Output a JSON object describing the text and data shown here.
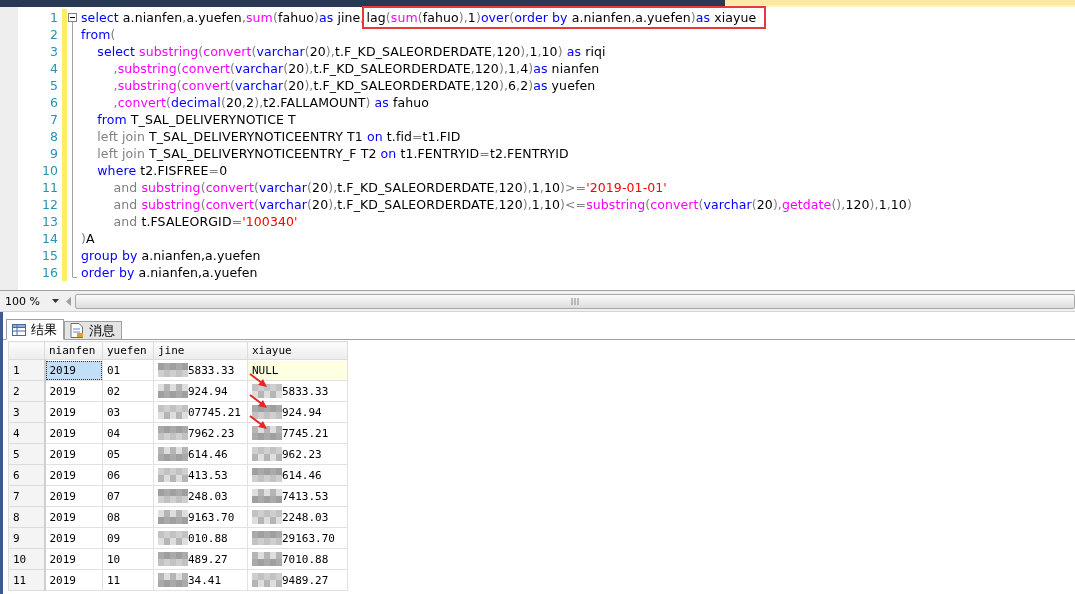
{
  "editor": {
    "lines": [
      {
        "number": "1",
        "segments": [
          {
            "boxed": false,
            "tokens": [
              {
                "kind": "keyword",
                "text": "select"
              },
              {
                "kind": "ident",
                "text": " a.nianfen"
              },
              {
                "kind": "punct",
                "text": ","
              },
              {
                "kind": "ident",
                "text": "a.yuefen"
              },
              {
                "kind": "punct",
                "text": ","
              },
              {
                "kind": "func",
                "text": "sum"
              },
              {
                "kind": "punct",
                "text": "("
              },
              {
                "kind": "ident",
                "text": "fahuo"
              },
              {
                "kind": "punct",
                "text": ")"
              },
              {
                "kind": "keyword",
                "text": "as"
              },
              {
                "kind": "ident",
                "text": " jine"
              },
              {
                "kind": "punct",
                "text": ","
              }
            ]
          },
          {
            "boxed": true,
            "tokens": [
              {
                "kind": "ident",
                "text": "lag"
              },
              {
                "kind": "punct",
                "text": "("
              },
              {
                "kind": "func",
                "text": "sum"
              },
              {
                "kind": "punct",
                "text": "("
              },
              {
                "kind": "ident",
                "text": "fahuo"
              },
              {
                "kind": "punct",
                "text": "),"
              },
              {
                "kind": "ident",
                "text": "1"
              },
              {
                "kind": "punct",
                "text": ")"
              },
              {
                "kind": "keyword",
                "text": "over"
              },
              {
                "kind": "punct",
                "text": "("
              },
              {
                "kind": "keyword",
                "text": "order by"
              },
              {
                "kind": "ident",
                "text": " a.nianfen"
              },
              {
                "kind": "punct",
                "text": ","
              },
              {
                "kind": "ident",
                "text": "a.yuefen"
              },
              {
                "kind": "punct",
                "text": ")"
              },
              {
                "kind": "keyword",
                "text": "as"
              },
              {
                "kind": "ident",
                "text": " xiayue"
              }
            ]
          }
        ]
      },
      {
        "number": "2",
        "segments": [
          {
            "boxed": false,
            "tokens": [
              {
                "kind": "keyword",
                "text": "from"
              },
              {
                "kind": "punct",
                "text": "("
              }
            ]
          }
        ]
      },
      {
        "number": "3",
        "segments": [
          {
            "boxed": false,
            "tokens": [
              {
                "kind": "keyword",
                "text": "    select "
              },
              {
                "kind": "func",
                "text": "substring"
              },
              {
                "kind": "punct",
                "text": "("
              },
              {
                "kind": "func",
                "text": "convert"
              },
              {
                "kind": "punct",
                "text": "("
              },
              {
                "kind": "keyword",
                "text": "varchar"
              },
              {
                "kind": "punct",
                "text": "("
              },
              {
                "kind": "ident",
                "text": "20"
              },
              {
                "kind": "punct",
                "text": "),"
              },
              {
                "kind": "ident",
                "text": "t.F_KD_SALEORDERDATE"
              },
              {
                "kind": "punct",
                "text": ","
              },
              {
                "kind": "ident",
                "text": "120"
              },
              {
                "kind": "punct",
                "text": "),"
              },
              {
                "kind": "ident",
                "text": "1"
              },
              {
                "kind": "punct",
                "text": ","
              },
              {
                "kind": "ident",
                "text": "10"
              },
              {
                "kind": "punct",
                "text": ") "
              },
              {
                "kind": "keyword",
                "text": "as"
              },
              {
                "kind": "ident",
                "text": " riqi"
              }
            ]
          }
        ]
      },
      {
        "number": "4",
        "segments": [
          {
            "boxed": false,
            "tokens": [
              {
                "kind": "punct",
                "text": "        ,"
              },
              {
                "kind": "func",
                "text": "substring"
              },
              {
                "kind": "punct",
                "text": "("
              },
              {
                "kind": "func",
                "text": "convert"
              },
              {
                "kind": "punct",
                "text": "("
              },
              {
                "kind": "keyword",
                "text": "varchar"
              },
              {
                "kind": "punct",
                "text": "("
              },
              {
                "kind": "ident",
                "text": "20"
              },
              {
                "kind": "punct",
                "text": "),"
              },
              {
                "kind": "ident",
                "text": "t.F_KD_SALEORDERDATE"
              },
              {
                "kind": "punct",
                "text": ","
              },
              {
                "kind": "ident",
                "text": "120"
              },
              {
                "kind": "punct",
                "text": "),"
              },
              {
                "kind": "ident",
                "text": "1"
              },
              {
                "kind": "punct",
                "text": ","
              },
              {
                "kind": "ident",
                "text": "4"
              },
              {
                "kind": "punct",
                "text": ")"
              },
              {
                "kind": "keyword",
                "text": "as"
              },
              {
                "kind": "ident",
                "text": " nianfen"
              }
            ]
          }
        ]
      },
      {
        "number": "5",
        "segments": [
          {
            "boxed": false,
            "tokens": [
              {
                "kind": "punct",
                "text": "        ,"
              },
              {
                "kind": "func",
                "text": "substring"
              },
              {
                "kind": "punct",
                "text": "("
              },
              {
                "kind": "func",
                "text": "convert"
              },
              {
                "kind": "punct",
                "text": "("
              },
              {
                "kind": "keyword",
                "text": "varchar"
              },
              {
                "kind": "punct",
                "text": "("
              },
              {
                "kind": "ident",
                "text": "20"
              },
              {
                "kind": "punct",
                "text": "),"
              },
              {
                "kind": "ident",
                "text": "t.F_KD_SALEORDERDATE"
              },
              {
                "kind": "punct",
                "text": ","
              },
              {
                "kind": "ident",
                "text": "120"
              },
              {
                "kind": "punct",
                "text": "),"
              },
              {
                "kind": "ident",
                "text": "6"
              },
              {
                "kind": "punct",
                "text": ","
              },
              {
                "kind": "ident",
                "text": "2"
              },
              {
                "kind": "punct",
                "text": ")"
              },
              {
                "kind": "keyword",
                "text": "as"
              },
              {
                "kind": "ident",
                "text": " yuefen"
              }
            ]
          }
        ]
      },
      {
        "number": "6",
        "segments": [
          {
            "boxed": false,
            "tokens": [
              {
                "kind": "punct",
                "text": "        ,"
              },
              {
                "kind": "func",
                "text": "convert"
              },
              {
                "kind": "punct",
                "text": "("
              },
              {
                "kind": "keyword",
                "text": "decimal"
              },
              {
                "kind": "punct",
                "text": "("
              },
              {
                "kind": "ident",
                "text": "20"
              },
              {
                "kind": "punct",
                "text": ","
              },
              {
                "kind": "ident",
                "text": "2"
              },
              {
                "kind": "punct",
                "text": "),"
              },
              {
                "kind": "ident",
                "text": "t2.FALLAMOUNT"
              },
              {
                "kind": "punct",
                "text": ") "
              },
              {
                "kind": "keyword",
                "text": "as"
              },
              {
                "kind": "ident",
                "text": " fahuo"
              }
            ]
          }
        ]
      },
      {
        "number": "7",
        "segments": [
          {
            "boxed": false,
            "tokens": [
              {
                "kind": "keyword",
                "text": "    from"
              },
              {
                "kind": "ident",
                "text": " T_SAL_DELIVERYNOTICE T"
              }
            ]
          }
        ]
      },
      {
        "number": "8",
        "segments": [
          {
            "boxed": false,
            "tokens": [
              {
                "kind": "punct",
                "text": "    left join"
              },
              {
                "kind": "ident",
                "text": " T_SAL_DELIVERYNOTICEENTRY T1 "
              },
              {
                "kind": "keyword",
                "text": "on"
              },
              {
                "kind": "ident",
                "text": " t.fid"
              },
              {
                "kind": "punct",
                "text": "="
              },
              {
                "kind": "ident",
                "text": "t1.FID"
              }
            ]
          }
        ]
      },
      {
        "number": "9",
        "segments": [
          {
            "boxed": false,
            "tokens": [
              {
                "kind": "punct",
                "text": "    left join"
              },
              {
                "kind": "ident",
                "text": " T_SAL_DELIVERYNOTICEENTRY_F T2 "
              },
              {
                "kind": "keyword",
                "text": "on"
              },
              {
                "kind": "ident",
                "text": " t1.FENTRYID"
              },
              {
                "kind": "punct",
                "text": "="
              },
              {
                "kind": "ident",
                "text": "t2.FENTRYID"
              }
            ]
          }
        ]
      },
      {
        "number": "10",
        "segments": [
          {
            "boxed": false,
            "tokens": [
              {
                "kind": "keyword",
                "text": "    where"
              },
              {
                "kind": "ident",
                "text": " t2.FISFREE"
              },
              {
                "kind": "punct",
                "text": "="
              },
              {
                "kind": "ident",
                "text": "0"
              }
            ]
          }
        ]
      },
      {
        "number": "11",
        "segments": [
          {
            "boxed": false,
            "tokens": [
              {
                "kind": "punct",
                "text": "        and "
              },
              {
                "kind": "func",
                "text": "substring"
              },
              {
                "kind": "punct",
                "text": "("
              },
              {
                "kind": "func",
                "text": "convert"
              },
              {
                "kind": "punct",
                "text": "("
              },
              {
                "kind": "keyword",
                "text": "varchar"
              },
              {
                "kind": "punct",
                "text": "("
              },
              {
                "kind": "ident",
                "text": "20"
              },
              {
                "kind": "punct",
                "text": "),"
              },
              {
                "kind": "ident",
                "text": "t.F_KD_SALEORDERDATE"
              },
              {
                "kind": "punct",
                "text": ","
              },
              {
                "kind": "ident",
                "text": "120"
              },
              {
                "kind": "punct",
                "text": "),"
              },
              {
                "kind": "ident",
                "text": "1"
              },
              {
                "kind": "punct",
                "text": ","
              },
              {
                "kind": "ident",
                "text": "10"
              },
              {
                "kind": "punct",
                "text": ")>="
              },
              {
                "kind": "string",
                "text": "'2019-01-01'"
              }
            ]
          }
        ]
      },
      {
        "number": "12",
        "segments": [
          {
            "boxed": false,
            "tokens": [
              {
                "kind": "punct",
                "text": "        and "
              },
              {
                "kind": "func",
                "text": "substring"
              },
              {
                "kind": "punct",
                "text": "("
              },
              {
                "kind": "func",
                "text": "convert"
              },
              {
                "kind": "punct",
                "text": "("
              },
              {
                "kind": "keyword",
                "text": "varchar"
              },
              {
                "kind": "punct",
                "text": "("
              },
              {
                "kind": "ident",
                "text": "20"
              },
              {
                "kind": "punct",
                "text": "),"
              },
              {
                "kind": "ident",
                "text": "t.F_KD_SALEORDERDATE"
              },
              {
                "kind": "punct",
                "text": ","
              },
              {
                "kind": "ident",
                "text": "120"
              },
              {
                "kind": "punct",
                "text": "),"
              },
              {
                "kind": "ident",
                "text": "1"
              },
              {
                "kind": "punct",
                "text": ","
              },
              {
                "kind": "ident",
                "text": "10"
              },
              {
                "kind": "punct",
                "text": ")<="
              },
              {
                "kind": "func",
                "text": "substring"
              },
              {
                "kind": "punct",
                "text": "("
              },
              {
                "kind": "func",
                "text": "convert"
              },
              {
                "kind": "punct",
                "text": "("
              },
              {
                "kind": "keyword",
                "text": "varchar"
              },
              {
                "kind": "punct",
                "text": "("
              },
              {
                "kind": "ident",
                "text": "20"
              },
              {
                "kind": "punct",
                "text": "),"
              },
              {
                "kind": "func",
                "text": "getdate"
              },
              {
                "kind": "punct",
                "text": "(),"
              },
              {
                "kind": "ident",
                "text": "120"
              },
              {
                "kind": "punct",
                "text": "),"
              },
              {
                "kind": "ident",
                "text": "1"
              },
              {
                "kind": "punct",
                "text": ","
              },
              {
                "kind": "ident",
                "text": "10"
              },
              {
                "kind": "punct",
                "text": ")"
              }
            ]
          }
        ]
      },
      {
        "number": "13",
        "segments": [
          {
            "boxed": false,
            "tokens": [
              {
                "kind": "punct",
                "text": "        and"
              },
              {
                "kind": "ident",
                "text": " t.FSALEORGID"
              },
              {
                "kind": "punct",
                "text": "="
              },
              {
                "kind": "string",
                "text": "'100340'"
              }
            ]
          }
        ]
      },
      {
        "number": "14",
        "segments": [
          {
            "boxed": false,
            "tokens": [
              {
                "kind": "punct",
                "text": ")"
              },
              {
                "kind": "ident",
                "text": "A"
              }
            ]
          }
        ]
      },
      {
        "number": "15",
        "segments": [
          {
            "boxed": false,
            "tokens": [
              {
                "kind": "keyword",
                "text": "group by"
              },
              {
                "kind": "ident",
                "text": " a.nianfen,a.yuefen"
              }
            ]
          }
        ]
      },
      {
        "number": "16",
        "segments": [
          {
            "boxed": false,
            "tokens": [
              {
                "kind": "keyword",
                "text": "order by"
              },
              {
                "kind": "ident",
                "text": " a.nianfen,a.yuefen"
              }
            ]
          }
        ]
      }
    ]
  },
  "zoom": {
    "value": "100 %"
  },
  "result_tabs": [
    {
      "label": "结果",
      "kind": "grid",
      "selected": true
    },
    {
      "label": "消息",
      "kind": "messages",
      "selected": false
    }
  ],
  "grid": {
    "columns": [
      "nianfen",
      "yuefen",
      "jine",
      "xiayue"
    ],
    "rows": [
      {
        "row": "1",
        "arrow_in": false,
        "cells": [
          {
            "text": "2019",
            "kind": "value",
            "selected": true
          },
          {
            "text": "01",
            "kind": "value",
            "selected": false
          },
          {
            "text": "5833.33",
            "kind": "masked",
            "selected": false
          },
          {
            "text": "NULL",
            "kind": "null",
            "selected": false
          }
        ]
      },
      {
        "row": "2",
        "arrow_in": true,
        "cells": [
          {
            "text": "2019",
            "kind": "value",
            "selected": false
          },
          {
            "text": "02",
            "kind": "value",
            "selected": false
          },
          {
            "text": "924.94",
            "kind": "masked",
            "selected": false
          },
          {
            "text": "5833.33",
            "kind": "masked",
            "selected": false
          }
        ]
      },
      {
        "row": "3",
        "arrow_in": true,
        "cells": [
          {
            "text": "2019",
            "kind": "value",
            "selected": false
          },
          {
            "text": "03",
            "kind": "value",
            "selected": false
          },
          {
            "text": "07745.21",
            "kind": "masked",
            "selected": false
          },
          {
            "text": "924.94",
            "kind": "masked",
            "selected": false
          }
        ]
      },
      {
        "row": "4",
        "arrow_in": true,
        "cells": [
          {
            "text": "2019",
            "kind": "value",
            "selected": false
          },
          {
            "text": "04",
            "kind": "value",
            "selected": false
          },
          {
            "text": "7962.23",
            "kind": "masked",
            "selected": false
          },
          {
            "text": "7745.21",
            "kind": "masked",
            "selected": false
          }
        ]
      },
      {
        "row": "5",
        "arrow_in": false,
        "cells": [
          {
            "text": "2019",
            "kind": "value",
            "selected": false
          },
          {
            "text": "05",
            "kind": "value",
            "selected": false
          },
          {
            "text": "614.46",
            "kind": "masked",
            "selected": false
          },
          {
            "text": "962.23",
            "kind": "masked",
            "selected": false
          }
        ]
      },
      {
        "row": "6",
        "arrow_in": false,
        "cells": [
          {
            "text": "2019",
            "kind": "value",
            "selected": false
          },
          {
            "text": "06",
            "kind": "value",
            "selected": false
          },
          {
            "text": "413.53",
            "kind": "masked",
            "selected": false
          },
          {
            "text": "614.46",
            "kind": "masked",
            "selected": false
          }
        ]
      },
      {
        "row": "7",
        "arrow_in": false,
        "cells": [
          {
            "text": "2019",
            "kind": "value",
            "selected": false
          },
          {
            "text": "07",
            "kind": "value",
            "selected": false
          },
          {
            "text": "248.03",
            "kind": "masked",
            "selected": false
          },
          {
            "text": "7413.53",
            "kind": "masked",
            "selected": false
          }
        ]
      },
      {
        "row": "8",
        "arrow_in": false,
        "cells": [
          {
            "text": "2019",
            "kind": "value",
            "selected": false
          },
          {
            "text": "08",
            "kind": "value",
            "selected": false
          },
          {
            "text": "9163.70",
            "kind": "masked",
            "selected": false
          },
          {
            "text": "2248.03",
            "kind": "masked",
            "selected": false
          }
        ]
      },
      {
        "row": "9",
        "arrow_in": false,
        "cells": [
          {
            "text": "2019",
            "kind": "value",
            "selected": false
          },
          {
            "text": "09",
            "kind": "value",
            "selected": false
          },
          {
            "text": "010.88",
            "kind": "masked",
            "selected": false
          },
          {
            "text": "29163.70",
            "kind": "masked",
            "selected": false
          }
        ]
      },
      {
        "row": "10",
        "arrow_in": false,
        "cells": [
          {
            "text": "2019",
            "kind": "value",
            "selected": false
          },
          {
            "text": "10",
            "kind": "value",
            "selected": false
          },
          {
            "text": "489.27",
            "kind": "masked",
            "selected": false
          },
          {
            "text": "7010.88",
            "kind": "masked",
            "selected": false
          }
        ]
      },
      {
        "row": "11",
        "arrow_in": false,
        "cells": [
          {
            "text": "2019",
            "kind": "value",
            "selected": false
          },
          {
            "text": "11",
            "kind": "value",
            "selected": false
          },
          {
            "text": "34.41",
            "kind": "masked",
            "selected": false
          },
          {
            "text": "9489.27",
            "kind": "masked",
            "selected": false
          }
        ]
      }
    ]
  }
}
